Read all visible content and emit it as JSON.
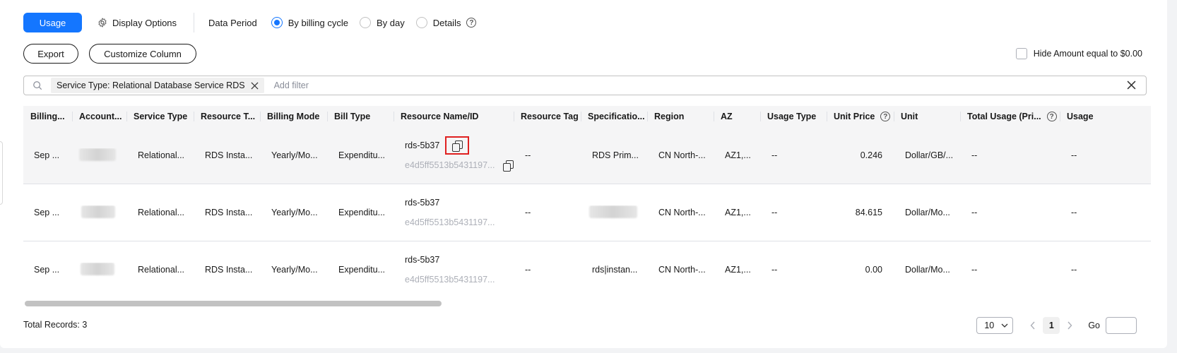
{
  "toolbar": {
    "usage_label": "Usage",
    "display_options_label": "Display Options",
    "data_period_label": "Data Period",
    "period_options": [
      {
        "label": "By billing cycle",
        "selected": true
      },
      {
        "label": "By day",
        "selected": false
      },
      {
        "label": "Details",
        "selected": false
      }
    ],
    "help_glyph": "?"
  },
  "actions": {
    "export_label": "Export",
    "customize_label": "Customize Column",
    "hide_amount_label": "Hide Amount equal to $0.00"
  },
  "filter": {
    "chip_label": "Service Type: Relational Database Service RDS",
    "placeholder": "Add filter"
  },
  "table": {
    "columns": [
      "Billing...",
      "Account...",
      "Service Type",
      "Resource T...",
      "Billing Mode",
      "Bill Type",
      "Resource Name/ID",
      "Resource Tag",
      "Specificatio...",
      "Region",
      "AZ",
      "Usage Type",
      "Unit Price",
      "Unit",
      "Total Usage (Pri...",
      "Usage"
    ],
    "rows": [
      {
        "billing": "Sep ...",
        "service": "Relational...",
        "resource_type": "RDS Insta...",
        "billing_mode": "Yearly/Mo...",
        "bill_type": "Expenditu...",
        "name": "rds-5b37",
        "id": "e4d5ff5513b5431197...",
        "tag": "--",
        "spec": "RDS Prim...",
        "region": "CN North-...",
        "az": "AZ1,...",
        "usage_type": "--",
        "unit_price": "0.246",
        "unit": "Dollar/GB/...",
        "total_usage": "--",
        "usage": "--"
      },
      {
        "billing": "Sep ...",
        "service": "Relational...",
        "resource_type": "RDS Insta...",
        "billing_mode": "Yearly/Mo...",
        "bill_type": "Expenditu...",
        "name": "rds-5b37",
        "id": "e4d5ff5513b5431197...",
        "tag": "--",
        "spec": "",
        "region": "CN North-...",
        "az": "AZ1,...",
        "usage_type": "--",
        "unit_price": "84.615",
        "unit": "Dollar/Mo...",
        "total_usage": "--",
        "usage": "--"
      },
      {
        "billing": "Sep ...",
        "service": "Relational...",
        "resource_type": "RDS Insta...",
        "billing_mode": "Yearly/Mo...",
        "bill_type": "Expenditu...",
        "name": "rds-5b37",
        "id": "e4d5ff5513b5431197...",
        "tag": "--",
        "spec": "rds|instan...",
        "region": "CN North-...",
        "az": "AZ1,...",
        "usage_type": "--",
        "unit_price": "0.00",
        "unit": "Dollar/Mo...",
        "total_usage": "--",
        "usage": "--"
      }
    ]
  },
  "footer": {
    "total_records": "Total Records: 3",
    "page_size": "10",
    "current_page": "1",
    "go_label": "Go"
  },
  "colors": {
    "primary": "#1476ff",
    "highlight": "#e02020"
  }
}
